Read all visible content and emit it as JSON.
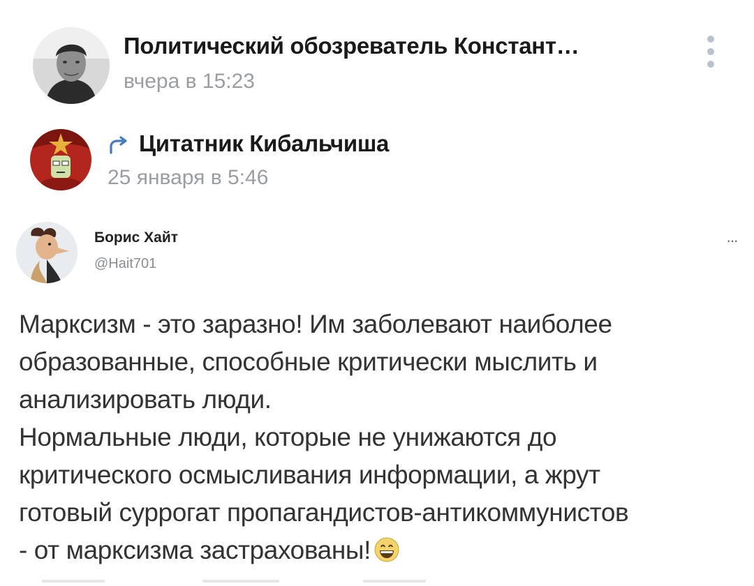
{
  "post": {
    "author": "Политический обозреватель Констант…",
    "time": "вчера в 15:23",
    "avatar_icon": "user-photo-avatar",
    "menu_icon": "more-vertical-icon"
  },
  "repost": {
    "icon": "repost-arrow-icon",
    "source": "Цитатник Кибальчиша",
    "time": "25 января в 5:46",
    "avatar_icon": "community-avatar"
  },
  "tweet": {
    "name": "Борис Хайт",
    "handle": "@Hait701",
    "more": "···",
    "lines": [
      "Марксизм - это заразно! Им заболевают наиболее",
      "образованные, способные критически мыслить и",
      "анализировать люди.",
      "Нормальные люди, которые не унижаются до",
      "критического осмысливания информации, а жрут",
      "готовый суррогат пропагандистов-антикоммунистов",
      "- от марксизма застрахованы!"
    ],
    "emoji_icon": "grinning-face-emoji-icon"
  },
  "colors": {
    "title": "#1a1a1a",
    "meta": "#9a9da1",
    "accent": "#447bba",
    "tweet_text": "#333333"
  }
}
